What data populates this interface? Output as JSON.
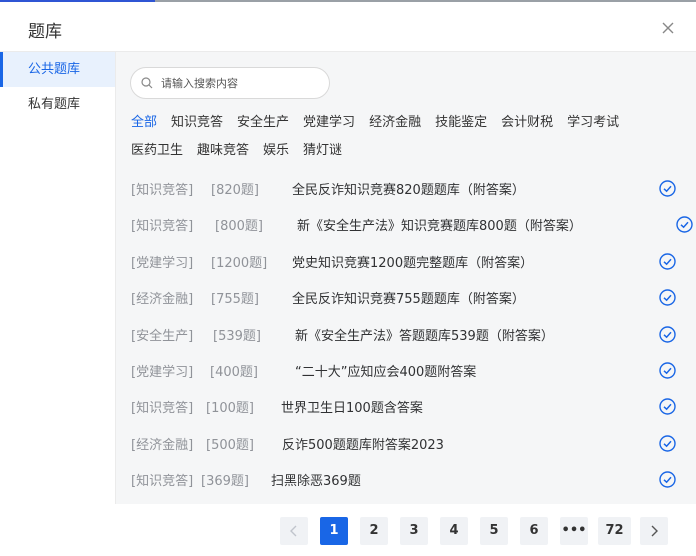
{
  "dialog": {
    "title": "题库"
  },
  "sidebar": {
    "items": [
      {
        "label": "公共题库"
      },
      {
        "label": "私有题库"
      }
    ]
  },
  "search": {
    "placeholder": "请输入搜索内容",
    "value": ""
  },
  "categories": [
    {
      "label": "全部"
    },
    {
      "label": "知识竞答"
    },
    {
      "label": "安全生产"
    },
    {
      "label": "党建学习"
    },
    {
      "label": "经济金融"
    },
    {
      "label": "技能鉴定"
    },
    {
      "label": "会计财税"
    },
    {
      "label": "学习考试"
    },
    {
      "label": "医药卫生"
    },
    {
      "label": "趣味竞答"
    },
    {
      "label": "娱乐"
    },
    {
      "label": "猜灯谜"
    }
  ],
  "bank_rows": [
    {
      "category": "[知识竞答]",
      "count": "[820题]",
      "title": "全民反诈知识竞赛820题题库（附答案）"
    },
    {
      "category": "[知识竞答]",
      "count": "[800题]",
      "title": "新《安全生产法》知识竞赛题库800题（附答案）"
    },
    {
      "category": "[党建学习]",
      "count": "[1200题]",
      "title": "党史知识竞赛1200题完整题库（附答案）"
    },
    {
      "category": "[经济金融]",
      "count": "[755题]",
      "title": "全民反诈知识竞赛755题题库（附答案）"
    },
    {
      "category": "[安全生产]",
      "count": "[539题]",
      "title": "新《安全生产法》答题题库539题（附答案）"
    },
    {
      "category": "[党建学习]",
      "count": "[400题]",
      "title": "“二十大”应知应会400题附答案"
    },
    {
      "category": "[知识竞答]",
      "count": "[100题]",
      "title": "世界卫生日100题含答案"
    },
    {
      "category": "[经济金融]",
      "count": "[500题]",
      "title": "反诈500题题库附答案2023"
    },
    {
      "category": "[知识竞答]",
      "count": "[369题]",
      "title": "扫黑除恶369题"
    }
  ],
  "pagination": {
    "pages": [
      "1",
      "2",
      "3",
      "4",
      "5",
      "6"
    ],
    "ellipsis": "•••",
    "last": "72",
    "current": "1"
  },
  "icons": {
    "search": "search-icon",
    "close": "close-icon",
    "check": "check-circle-icon",
    "prev": "chevron-left-icon",
    "next": "chevron-right-icon"
  },
  "colors": {
    "accent": "#1966e6",
    "muted": "#909399",
    "panel": "#f5f6f7"
  }
}
